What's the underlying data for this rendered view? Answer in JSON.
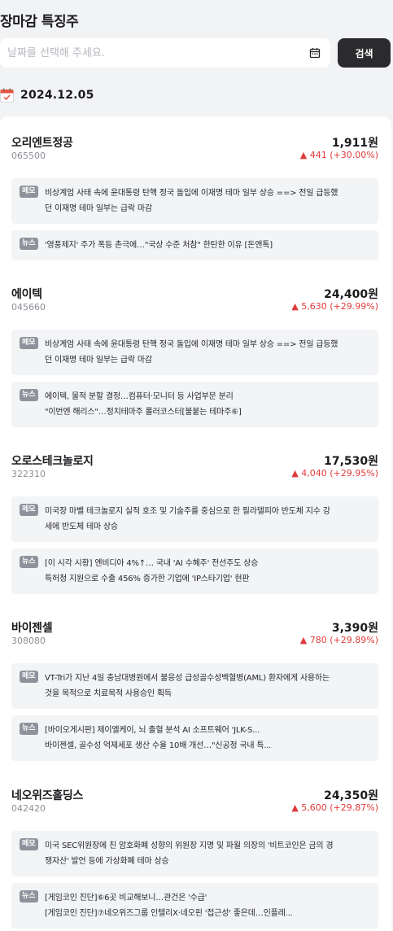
{
  "page": {
    "title": "장마감 특징주"
  },
  "search": {
    "placeholder": "날짜를 선택해 주세요.",
    "button_label": "검색"
  },
  "date_heading": "2024.12.05",
  "colors": {
    "up": "#e03b3b",
    "button": "#2b2b2e",
    "badge": "#8e939b"
  },
  "stocks": [
    {
      "name": "오리엔트정공",
      "code": "065500",
      "price": "1,911원",
      "change": "▲ 441 (+30.00%)",
      "memo": {
        "badge": "메모",
        "lines": [
          "비상계엄 사태 속에 윤대통령 탄핵 정국 돌입에 이재명 테마 일부 상승 ==> 전일 급등했",
          "던 이재명 테마 일부는 급락 마감"
        ]
      },
      "news": {
        "badge": "뉴스",
        "lines": [
          "'영풍제지' 주가 폭등 촌극에…\"국상 수준 처참\" 한탄한 이유 [돈앤톡]"
        ]
      }
    },
    {
      "name": "에이텍",
      "code": "045660",
      "price": "24,400원",
      "change": "▲ 5,630 (+29.99%)",
      "memo": {
        "badge": "메모",
        "lines": [
          "비상계엄 사태 속에 윤대통령 탄핵 정국 돌입에 이재명 테마 일부 상승 ==> 전일 급등했",
          "던 이재명 테마 일부는 급락 마감"
        ]
      },
      "news": {
        "badge": "뉴스",
        "lines": [
          "에이텍, 물적 분할 결정…컴퓨터·모니터 등 사업부문 분리",
          "\"이번엔 해리스\"…정치테마주 롤러코스터[불붙는 테마주⑥]"
        ]
      }
    },
    {
      "name": "오로스테크놀로지",
      "code": "322310",
      "price": "17,530원",
      "change": "▲ 4,040 (+29.95%)",
      "memo": {
        "badge": "메모",
        "lines": [
          "미국장 마벨 테크놀로지 실적 호조 및 기술주를 중심으로 한 필라델피아 반도체 지수 강",
          "세에 반도체 테마 상승"
        ]
      },
      "news": {
        "badge": "뉴스",
        "lines": [
          "[이 시각 시황] 엔비디아 4%↑… 국내 'AI 수혜주' 전선주도 상승",
          "특허청 지원으로 수출 456% 증가한 기업에 'IP스타기업' 현판"
        ]
      }
    },
    {
      "name": "바이젠셀",
      "code": "308080",
      "price": "3,390원",
      "change": "▲ 780 (+29.89%)",
      "memo": {
        "badge": "메모",
        "lines": [
          "VT-Tri가 지난 4일 충남대병원에서 불응성 급성골수성백혈병(AML) 환자에게 사용하는",
          "것을 목적으로 치료목적 사용승인 획득"
        ]
      },
      "news": {
        "badge": "뉴스",
        "lines": [
          "[바이오게시판] 제이엘케이, 뇌 출혈 분석 AI 소프트웨어 'JLK-S...",
          "바이젠셀, 골수성 억제세포 생산 수율 10배 개선…\"신공정 국내 특..."
        ]
      }
    },
    {
      "name": "네오위즈홀딩스",
      "code": "042420",
      "price": "24,350원",
      "change": "▲ 5,600 (+29.87%)",
      "memo": {
        "badge": "메모",
        "lines": [
          "미국 SEC위원장에 친 암호화폐 성향의 위원장 지명 및 파월 의장의  '비트코인은 금의 경",
          "쟁자산' 발언 등에 가상화폐 테마 상승"
        ]
      },
      "news": {
        "badge": "뉴스",
        "lines": [
          "[게임코인 진단]⑥6곳 비교해보니…관건은 '수급'",
          "[게임코인 진단]⑦네오위즈그룹 인텔리X·네오핀 '접근성' 좋은데…인플레..."
        ]
      }
    }
  ]
}
